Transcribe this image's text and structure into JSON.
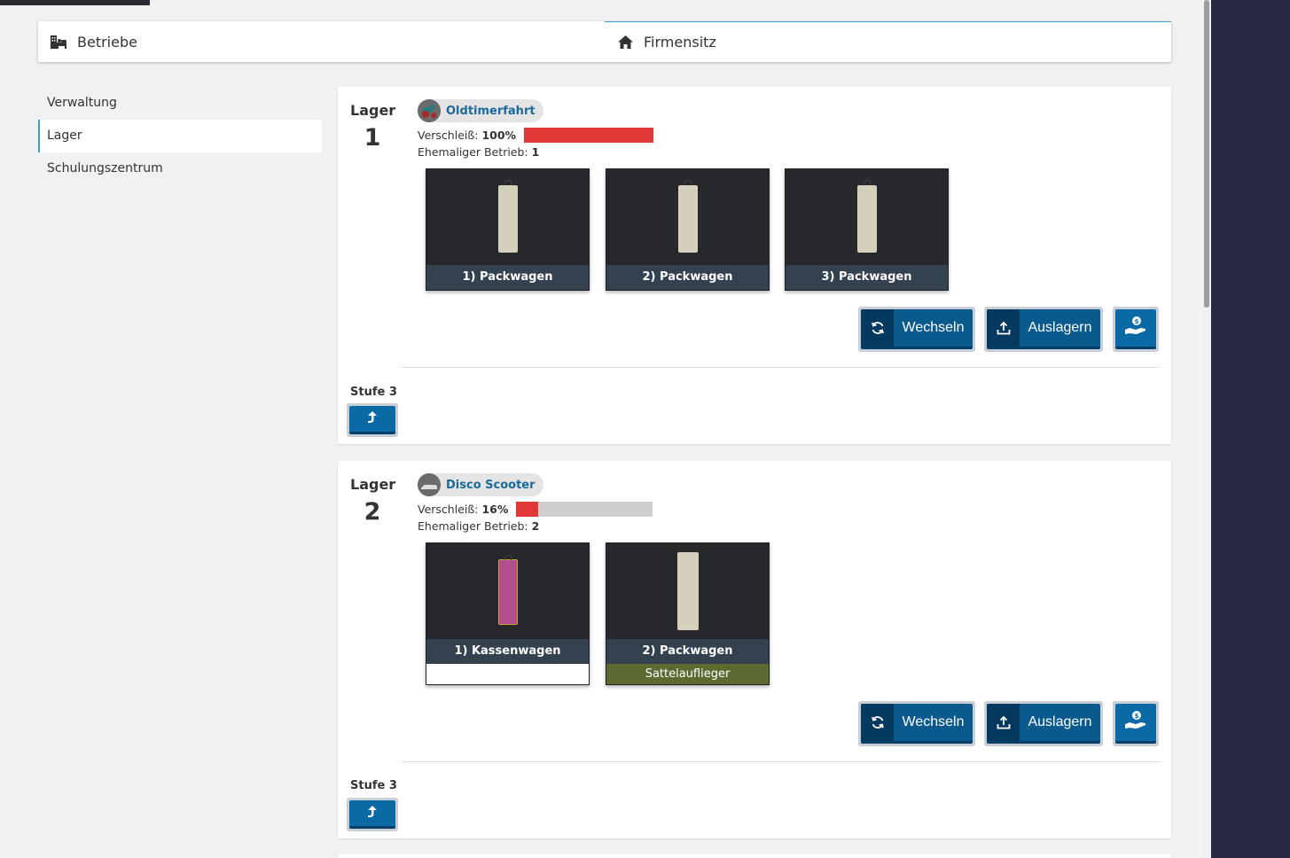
{
  "tabs": [
    {
      "label": "Betriebe",
      "icon": "building-bed-icon"
    },
    {
      "label": "Firmensitz",
      "icon": "home-icon"
    }
  ],
  "sidebar": {
    "items": [
      {
        "label": "Verwaltung"
      },
      {
        "label": "Lager"
      },
      {
        "label": "Schulungszentrum"
      }
    ]
  },
  "cards": [
    {
      "lager_label": "Lager",
      "lager_num": "1",
      "business_name": "Oldtimerfahrt",
      "wear_label": "Verschleiß:",
      "wear_value": "100%",
      "wear_fraction": 1.0,
      "former_label": "Ehemaliger Betrieb:",
      "former_value": "1",
      "vehicles": [
        {
          "label": "1) Packwagen"
        },
        {
          "label": "2) Packwagen"
        },
        {
          "label": "3) Packwagen"
        }
      ],
      "btn_switch": "Wechseln",
      "btn_unload": "Auslagern",
      "stufe": "Stufe 3"
    },
    {
      "lager_label": "Lager",
      "lager_num": "2",
      "business_name": "Disco Scooter",
      "wear_label": "Verschleiß:",
      "wear_value": "16%",
      "wear_fraction": 0.16,
      "former_label": "Ehemaliger Betrieb:",
      "former_value": "2",
      "vehicles": [
        {
          "label": "1) Kassenwagen",
          "extra": ""
        },
        {
          "label": "2) Packwagen",
          "extra": "Sattelauflieger"
        }
      ],
      "btn_switch": "Wechseln",
      "btn_unload": "Auslagern",
      "stufe": "Stufe 3"
    }
  ],
  "colors": {
    "accent": "#3aa1c9",
    "button_blue": "#0b5a8e",
    "wear_red": "#e03737",
    "name_blue": "#1a6a9c",
    "trailer_beige": "#d5d0bc",
    "trailer_pink": "#b34f8e",
    "extra_green": "#5b6b31"
  }
}
